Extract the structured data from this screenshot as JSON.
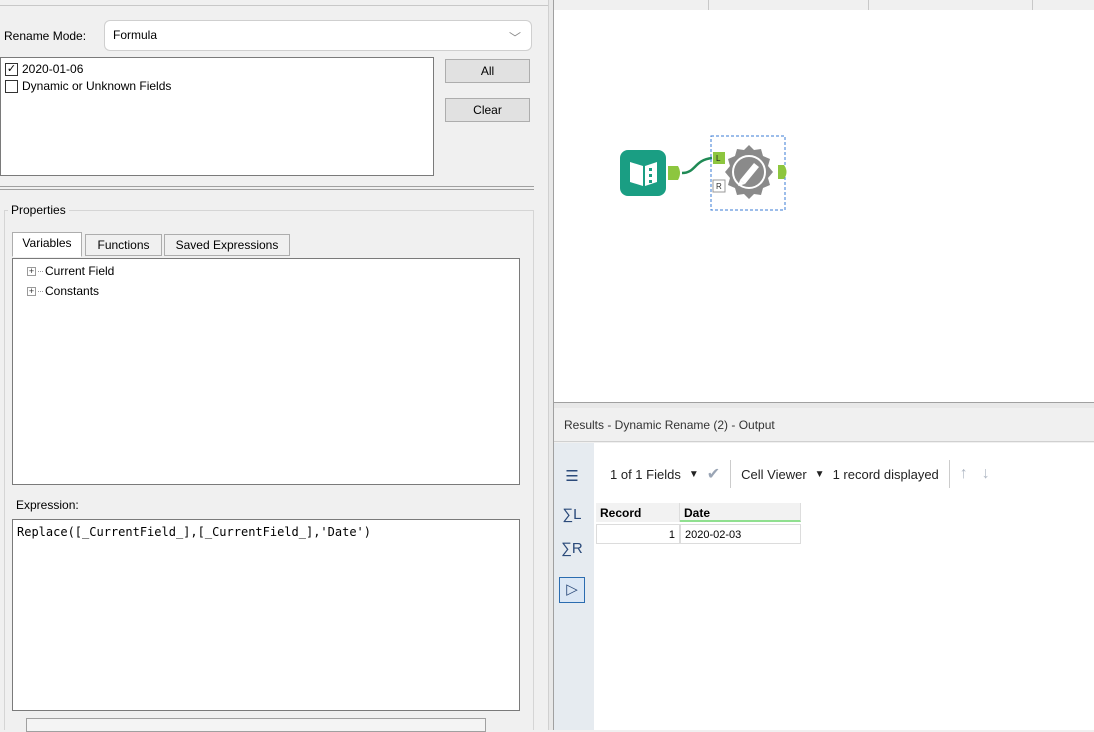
{
  "config": {
    "rename_mode_label": "Rename Mode:",
    "rename_mode_value": "Formula",
    "fields": [
      {
        "label": "2020-01-06",
        "checked": true
      },
      {
        "label": "Dynamic or Unknown Fields",
        "checked": false
      }
    ],
    "all_button": "All",
    "clear_button": "Clear",
    "properties_label": "Properties",
    "tabs": [
      {
        "label": "Variables",
        "active": true
      },
      {
        "label": "Functions",
        "active": false
      },
      {
        "label": "Saved Expressions",
        "active": false
      }
    ],
    "tree": [
      "Current Field",
      "Constants"
    ],
    "expression_label": "Expression:",
    "expression": "Replace([_CurrentField_],[_CurrentField_],'Date')"
  },
  "results": {
    "title": "Results - Dynamic Rename (2) - Output",
    "fields_selector": "1 of 1 Fields",
    "cell_viewer": "Cell Viewer",
    "records_displayed": "1 record displayed",
    "columns": [
      "Record",
      "Date"
    ],
    "rows": [
      [
        "1",
        "2020-02-03"
      ]
    ]
  },
  "colors": {
    "input_tool": "#1a9e83",
    "tool_connector": "#8dc63f",
    "dynamic_rename_tool": "#8a8a8a",
    "accent": "#2b6cb0"
  }
}
